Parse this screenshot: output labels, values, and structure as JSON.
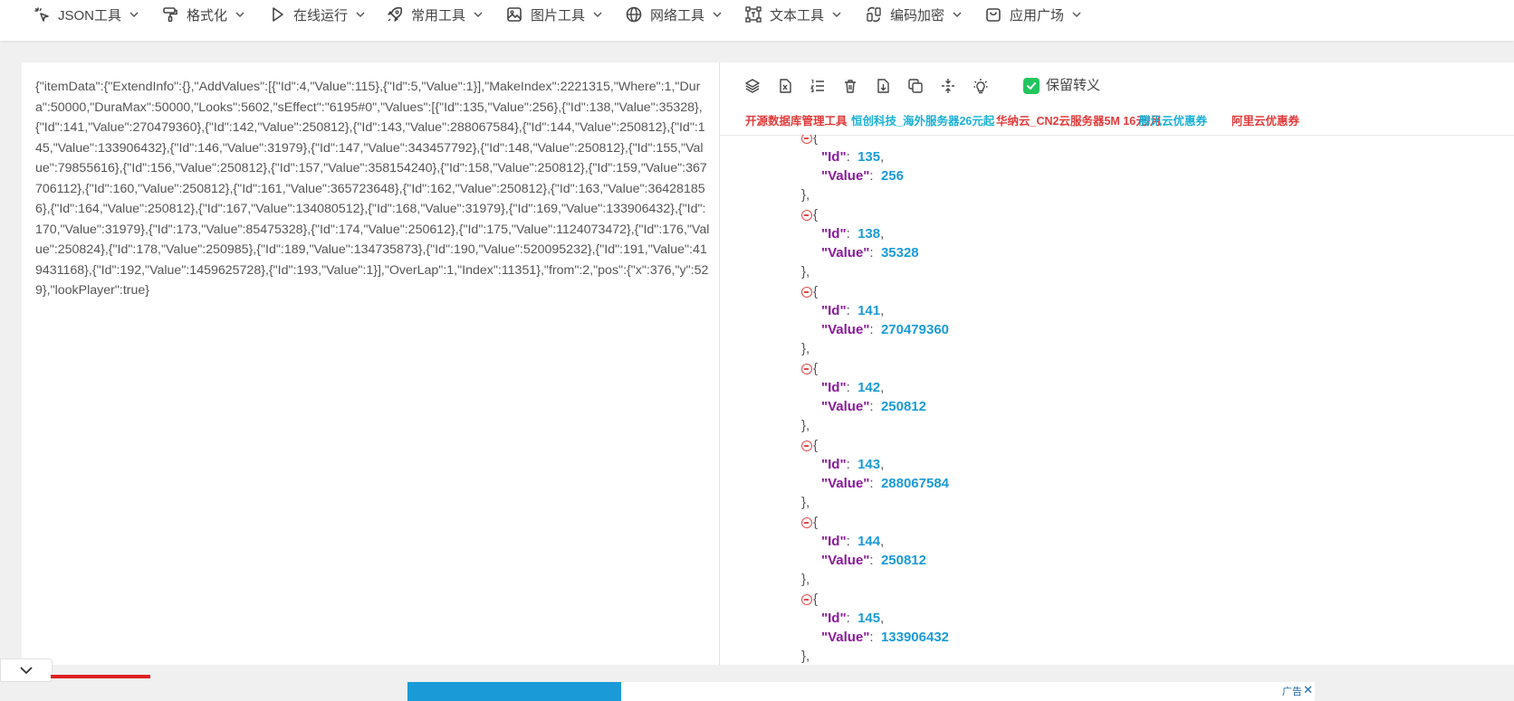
{
  "nav": {
    "items": [
      {
        "label": "JSON工具",
        "icon": "pointer-sparkle-icon"
      },
      {
        "label": "格式化",
        "icon": "paint-roller-icon"
      },
      {
        "label": "在线运行",
        "icon": "play-icon"
      },
      {
        "label": "常用工具",
        "icon": "rocket-icon"
      },
      {
        "label": "图片工具",
        "icon": "image-icon"
      },
      {
        "label": "网络工具",
        "icon": "globe-icon"
      },
      {
        "label": "文本工具",
        "icon": "text-frame-icon"
      },
      {
        "label": "编码加密",
        "icon": "encode-icon"
      },
      {
        "label": "应用广场",
        "icon": "app-store-icon"
      }
    ]
  },
  "input": {
    "text": "{\"itemData\":{\"ExtendInfo\":{},\"AddValues\":[{\"Id\":4,\"Value\":115},{\"Id\":5,\"Value\":1}],\"MakeIndex\":2221315,\"Where\":1,\"Dura\":50000,\"DuraMax\":50000,\"Looks\":5602,\"sEffect\":\"6195#0\",\"Values\":[{\"Id\":135,\"Value\":256},{\"Id\":138,\"Value\":35328},{\"Id\":141,\"Value\":270479360},{\"Id\":142,\"Value\":250812},{\"Id\":143,\"Value\":288067584},{\"Id\":144,\"Value\":250812},{\"Id\":145,\"Value\":133906432},{\"Id\":146,\"Value\":31979},{\"Id\":147,\"Value\":343457792},{\"Id\":148,\"Value\":250812},{\"Id\":155,\"Value\":79855616},{\"Id\":156,\"Value\":250812},{\"Id\":157,\"Value\":358154240},{\"Id\":158,\"Value\":250812},{\"Id\":159,\"Value\":367706112},{\"Id\":160,\"Value\":250812},{\"Id\":161,\"Value\":365723648},{\"Id\":162,\"Value\":250812},{\"Id\":163,\"Value\":364281856},{\"Id\":164,\"Value\":250812},{\"Id\":167,\"Value\":134080512},{\"Id\":168,\"Value\":31979},{\"Id\":169,\"Value\":133906432},{\"Id\":170,\"Value\":31979},{\"Id\":173,\"Value\":85475328},{\"Id\":174,\"Value\":250612},{\"Id\":175,\"Value\":1124073472},{\"Id\":176,\"Value\":250824},{\"Id\":178,\"Value\":250985},{\"Id\":189,\"Value\":134735873},{\"Id\":190,\"Value\":520095232},{\"Id\":191,\"Value\":419431168},{\"Id\":192,\"Value\":1459625728},{\"Id\":193,\"Value\":1}],\"OverLap\":1,\"Index\":11351},\"from\":2,\"pos\":{\"x\":376,\"y\":529},\"lookPlayer\":true}"
  },
  "toolbar": {
    "icons": [
      "layers-icon",
      "excel-icon",
      "ordered-list-icon",
      "trash-icon",
      "download-file-icon",
      "copy-icon",
      "compress-icon",
      "lightbulb-icon"
    ],
    "keep_escape_label": "保留转义",
    "keep_escape_checked": true
  },
  "links": [
    {
      "label": "开源数据库管理工具",
      "color": "#e23a3a"
    },
    {
      "label": "恒创科技_海外服务器26元起",
      "color": "#19b0d6"
    },
    {
      "label": "华纳云_CN2云服务器5M 16元/月",
      "color": "#e23a3a"
    },
    {
      "label": "腾讯云优惠券",
      "color": "#19b0d6"
    },
    {
      "label": "阿里云优惠券",
      "color": "#e23a3a"
    }
  ],
  "json_view": {
    "entries": [
      {
        "id": "135",
        "value": "256"
      },
      {
        "id": "138",
        "value": "35328"
      },
      {
        "id": "141",
        "value": "270479360"
      },
      {
        "id": "142",
        "value": "250812"
      },
      {
        "id": "143",
        "value": "288067584"
      },
      {
        "id": "144",
        "value": "250812"
      },
      {
        "id": "145",
        "value": "133906432"
      }
    ],
    "key_id": "\"Id\"",
    "key_value": "\"Value\""
  },
  "ad": {
    "label": "广告",
    "close": "✕"
  }
}
